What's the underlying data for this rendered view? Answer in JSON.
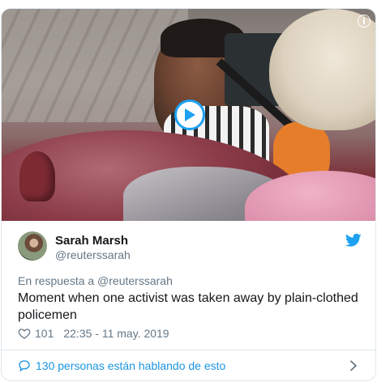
{
  "media": {
    "info_glyph": "i",
    "icons": {
      "play": "play-icon",
      "info": "info-icon"
    },
    "accent_color": "#1da1f2"
  },
  "author": {
    "name": "Sarah Marsh",
    "handle": "@reuterssarah"
  },
  "tweet": {
    "reply_to": "En respuesta a @reuterssarah",
    "text": "Moment when one activist was taken away by plain-clothed policemen",
    "like_count": "101",
    "timestamp": "22:35 - 11 may. 2019"
  },
  "conversation": {
    "label": "130 personas están hablando de esto"
  },
  "colors": {
    "link_blue": "#1b95e0",
    "secondary_text": "#657786",
    "primary_text": "#14171a",
    "border": "#e1e8ed"
  }
}
